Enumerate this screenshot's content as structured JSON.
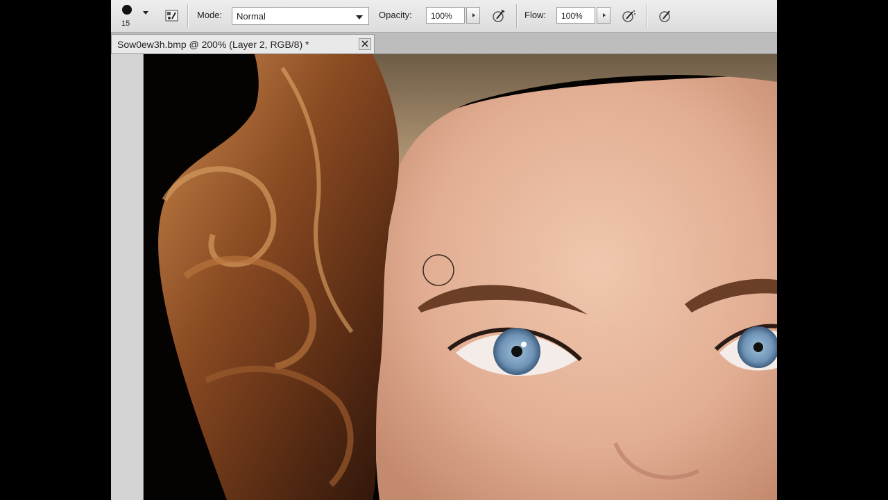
{
  "options_bar": {
    "brush_size": "15",
    "mode_label": "Mode:",
    "mode_value": "Normal",
    "opacity_label": "Opacity:",
    "opacity_value": "100%",
    "flow_label": "Flow:",
    "flow_value": "100%"
  },
  "document": {
    "tab_title": "Sow0ew3h.bmp @ 200% (Layer 2, RGB/8) *"
  },
  "icons": {
    "brush_preset": "brush-preset-icon",
    "toggle_brush_panel": "brush-panel-icon",
    "airbrush": "airbrush-icon",
    "tablet_pressure": "tablet-pressure-icon",
    "close": "close-icon"
  },
  "colors": {
    "options_bar_bg": "#e4e4e4",
    "canvas_bg": "#050302",
    "skin": "#e6b49b",
    "hair": "#8a4a22",
    "iris": "#7da2c4"
  }
}
